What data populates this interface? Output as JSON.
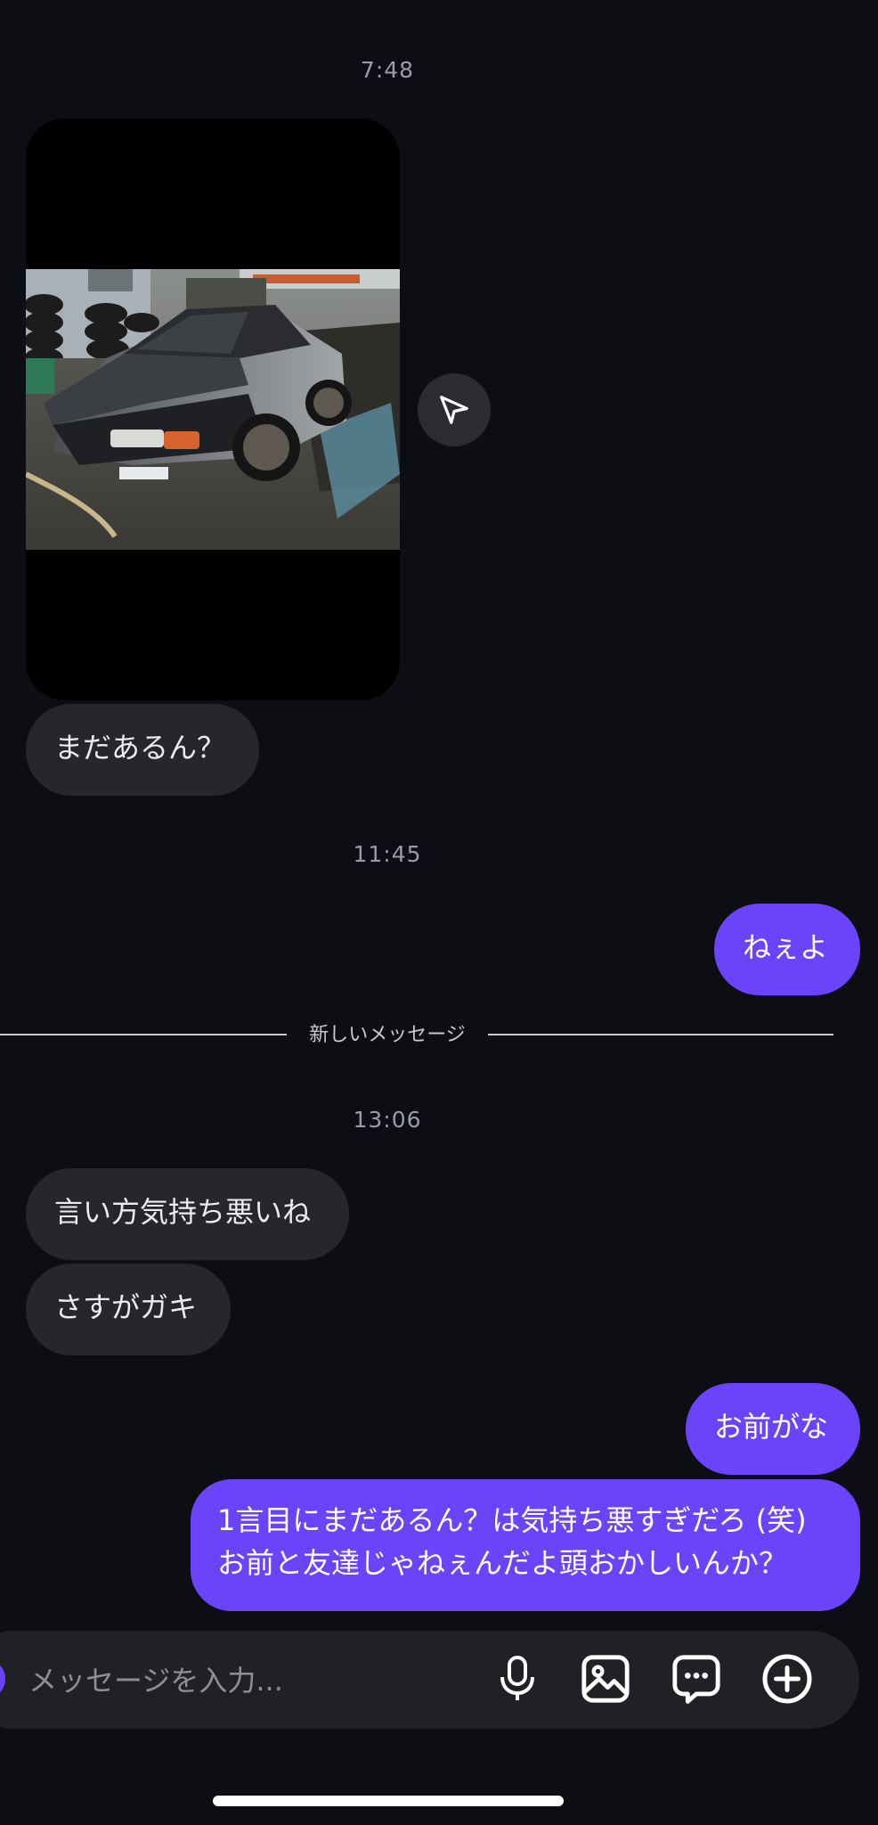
{
  "conversation": {
    "time_1": "7:48",
    "msg_in_1": "まだあるん？",
    "time_2": "11:45",
    "msg_out_1": "ねぇよ",
    "new_messages_label": "新しいメッセージ",
    "time_3": "13:06",
    "msg_in_2": "言い方気持ち悪いね",
    "msg_in_3": "さすがガキ",
    "msg_out_2": "お前がな",
    "msg_out_3_line1": "1言目にまだあるん？は気持ち悪すぎだろ (笑)",
    "msg_out_3_line2": "お前と友達じゃねぇんだよ頭おかしいんか？"
  },
  "composer": {
    "placeholder": "メッセージを入力..."
  },
  "icons": {
    "share": "send-icon",
    "mic": "microphone-icon",
    "gallery": "image-icon",
    "sticker": "chat-bubble-icon",
    "more": "plus-circle-icon"
  },
  "colors": {
    "background": "#0c0e13",
    "incoming_bubble": "#25272c",
    "outgoing_bubble": "#6a43fa",
    "muted_text": "#9a9ca3"
  }
}
